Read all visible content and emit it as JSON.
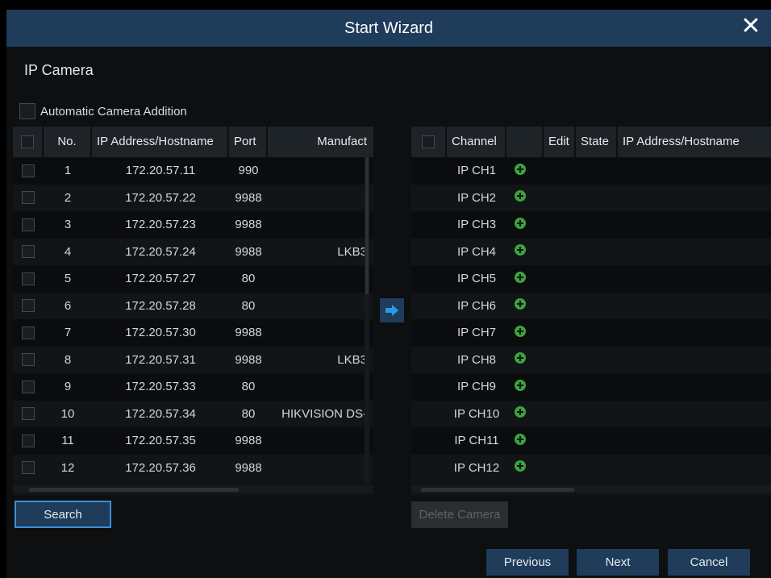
{
  "window": {
    "title": "Start Wizard"
  },
  "section_title": "IP Camera",
  "auto_addition_label": "Automatic Camera Addition",
  "left_table": {
    "headers": {
      "no": "No.",
      "ip": "IP Address/Hostname",
      "port": "Port",
      "manufacturer": "Manufact"
    },
    "rows": [
      {
        "no": "1",
        "ip": "172.20.57.11",
        "port": "990",
        "manufacturer": ""
      },
      {
        "no": "2",
        "ip": "172.20.57.22",
        "port": "9988",
        "manufacturer": ""
      },
      {
        "no": "3",
        "ip": "172.20.57.23",
        "port": "9988",
        "manufacturer": ""
      },
      {
        "no": "4",
        "ip": "172.20.57.24",
        "port": "9988",
        "manufacturer": "LKB3"
      },
      {
        "no": "5",
        "ip": "172.20.57.27",
        "port": "80",
        "manufacturer": ""
      },
      {
        "no": "6",
        "ip": "172.20.57.28",
        "port": "80",
        "manufacturer": ""
      },
      {
        "no": "7",
        "ip": "172.20.57.30",
        "port": "9988",
        "manufacturer": ""
      },
      {
        "no": "8",
        "ip": "172.20.57.31",
        "port": "9988",
        "manufacturer": "LKB3"
      },
      {
        "no": "9",
        "ip": "172.20.57.33",
        "port": "80",
        "manufacturer": ""
      },
      {
        "no": "10",
        "ip": "172.20.57.34",
        "port": "80",
        "manufacturer": "HIKVISION DS-"
      },
      {
        "no": "11",
        "ip": "172.20.57.35",
        "port": "9988",
        "manufacturer": ""
      },
      {
        "no": "12",
        "ip": "172.20.57.36",
        "port": "9988",
        "manufacturer": ""
      }
    ]
  },
  "right_table": {
    "headers": {
      "channel": "Channel",
      "edit": "Edit",
      "state": "State",
      "ip": "IP Address/Hostname"
    },
    "rows": [
      {
        "channel": "IP CH1"
      },
      {
        "channel": "IP CH2"
      },
      {
        "channel": "IP CH3"
      },
      {
        "channel": "IP CH4"
      },
      {
        "channel": "IP CH5"
      },
      {
        "channel": "IP CH6"
      },
      {
        "channel": "IP CH7"
      },
      {
        "channel": "IP CH8"
      },
      {
        "channel": "IP CH9"
      },
      {
        "channel": "IP CH10"
      },
      {
        "channel": "IP CH11"
      },
      {
        "channel": "IP CH12"
      }
    ]
  },
  "buttons": {
    "search": "Search",
    "delete_camera": "Delete Camera",
    "previous": "Previous",
    "next": "Next",
    "cancel": "Cancel"
  },
  "colors": {
    "accent": "#1f3c5a",
    "add_icon": "#3aa53a",
    "arrow": "#2a9be8"
  }
}
